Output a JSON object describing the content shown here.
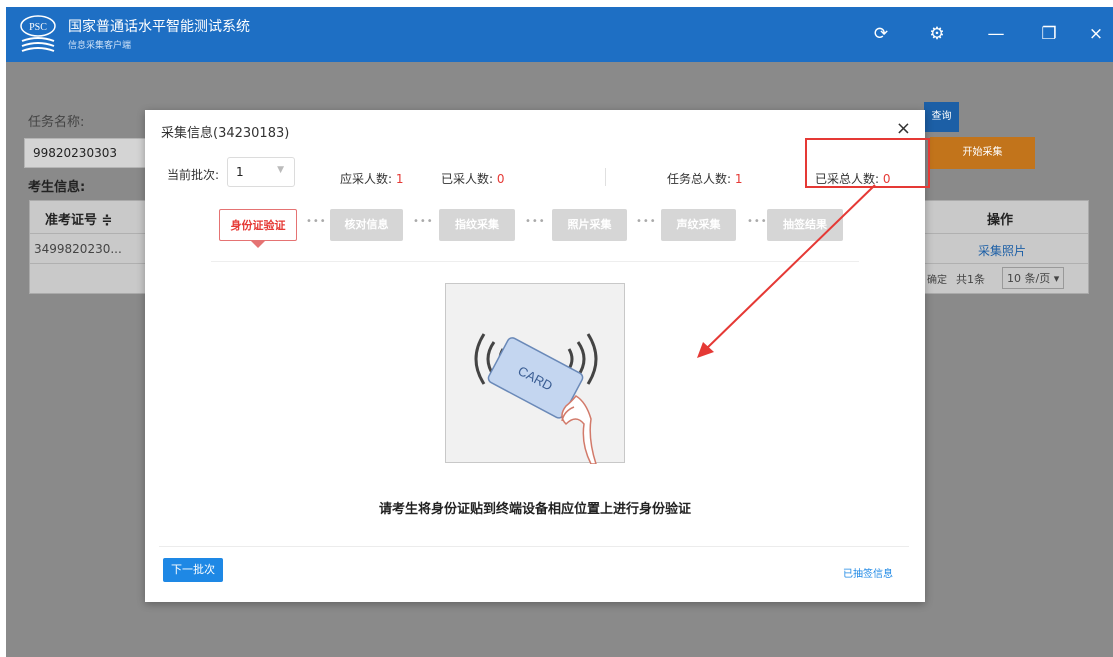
{
  "app": {
    "logo_text": "PSC",
    "title": "国家普通话水平智能测试系统",
    "subtitle": "信息采集客户端"
  },
  "window_controls": {
    "refresh": "⟳",
    "settings": "⚙",
    "minimize": "—",
    "restore": "❐",
    "close": "×"
  },
  "background": {
    "task_label": "任务名称:",
    "task_value": "99820230303",
    "examinee_label": "考生信息:",
    "query_button": "查询",
    "start_button": "开始采集",
    "table": {
      "col_ticket": "准考证号 ≑",
      "col_op": "操作",
      "row_ticket": "3499820230...",
      "row_action": "采集照片"
    },
    "pagination": {
      "confirm": "确定",
      "total": "共1条",
      "page_size": "10 条/页 ▾"
    }
  },
  "modal": {
    "title": "采集信息(34230183)",
    "close": "×",
    "batch_label": "当前批次:",
    "batch_value": "1",
    "batch_arrow": "▼",
    "should_collect_label": "应采人数:",
    "should_collect_value": "1",
    "collected_label": "已采人数:",
    "collected_value": "0",
    "task_total_label": "任务总人数:",
    "task_total_value": "1",
    "collected_total_label": "已采总人数:",
    "collected_total_value": "0",
    "steps": [
      "身份证验证",
      "核对信息",
      "指纹采集",
      "照片采集",
      "声纹采集",
      "抽签结果"
    ],
    "step_dots": "•••",
    "card_text": "CARD",
    "instruction": "请考生将身份证贴到终端设备相应位置上进行身份验证",
    "next_batch_button": "下一批次",
    "lot_info_link": "已抽签信息"
  }
}
